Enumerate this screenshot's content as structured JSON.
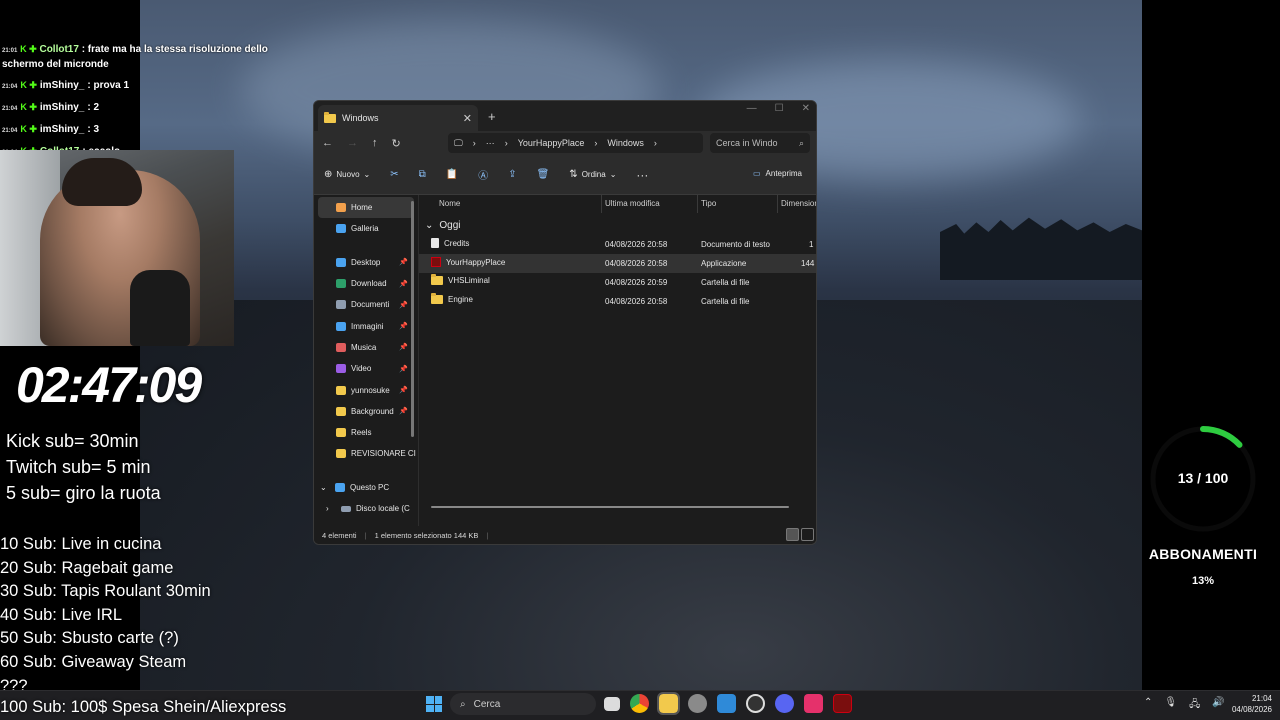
{
  "chat": [
    {
      "time": "21:01",
      "user": "Collot17",
      "user_color": "#b6ff9c",
      "message": ": frate ma ha la stessa risoluzione dello schermo del micronde"
    },
    {
      "time": "21:04",
      "user": "imShiny_",
      "user_color": "#ffffff",
      "message": ": prova 1"
    },
    {
      "time": "21:04",
      "user": "imShiny_",
      "user_color": "#ffffff",
      "message": ": 2"
    },
    {
      "time": "21:04",
      "user": "imShiny_",
      "user_color": "#ffffff",
      "message": ": 3"
    },
    {
      "time": "21:04",
      "user": "Collot17",
      "user_color": "#b6ff9c",
      "message": ": eccolo"
    }
  ],
  "stream": {
    "timer": "02:47:09",
    "rules": [
      "Kick sub= 30min",
      "Twitch sub= 5 min",
      "5 sub= giro la ruota"
    ],
    "goals": [
      "10 Sub: Live in cucina",
      "20 Sub: Ragebait game",
      "30 Sub: Tapis Roulant 30min",
      "40 Sub: Live IRL",
      "50 Sub: Sbusto carte (?)",
      "60 Sub: Giveaway Steam",
      "???",
      "100 Sub: 100$ Spesa Shein/Aliexpress"
    ]
  },
  "subs_gauge": {
    "count": "13 / 100",
    "title": "ABBONAMENTI",
    "percent_label": "13%",
    "progress": 0.13,
    "color": "#2ecc40"
  },
  "explorer": {
    "tab_title": "Windows",
    "address": {
      "crumbs": [
        "YourHappyPlace",
        "Windows"
      ]
    },
    "search_placeholder": "Cerca in Windo",
    "toolbar": {
      "new_label": "Nuovo",
      "sort_label": "Ordina",
      "preview_label": "Anteprima"
    },
    "sidebar": {
      "top": [
        {
          "label": "Home",
          "icon": "home-icon",
          "color": "#f2a04c"
        },
        {
          "label": "Galleria",
          "icon": "gallery-icon",
          "color": "#4aa3f0"
        }
      ],
      "pinned": [
        {
          "label": "Desktop",
          "icon": "desktop-icon",
          "color": "#4aa3f0"
        },
        {
          "label": "Download",
          "icon": "download-icon",
          "color": "#2d9f6a"
        },
        {
          "label": "Documenti",
          "icon": "documents-icon",
          "color": "#8f9db0"
        },
        {
          "label": "Immagini",
          "icon": "pictures-icon",
          "color": "#4aa3f0"
        },
        {
          "label": "Musica",
          "icon": "music-icon",
          "color": "#e05d5d"
        },
        {
          "label": "Video",
          "icon": "video-icon",
          "color": "#9b5de5"
        },
        {
          "label": "yunnosuke",
          "icon": "folder-icon",
          "color": "#f2c94c"
        },
        {
          "label": "Background",
          "icon": "folder-icon",
          "color": "#f2c94c"
        },
        {
          "label": "Reels",
          "icon": "folder-icon",
          "color": "#f2c94c"
        },
        {
          "label": "REVISIONARE CI",
          "icon": "folder-icon",
          "color": "#f2c94c"
        }
      ],
      "this_pc": "Questo PC",
      "local_disk": "Disco locale (C"
    },
    "columns": [
      "Nome",
      "Ultima modifica",
      "Tipo",
      "Dimension"
    ],
    "group_label": "Oggi",
    "files": [
      {
        "name": "Credits",
        "modified": "04/08/2026 20:58",
        "type": "Documento di testo",
        "size": "1 I",
        "icon": "text-document-icon"
      },
      {
        "name": "YourHappyPlace",
        "modified": "04/08/2026 20:58",
        "type": "Applicazione",
        "size": "144 I",
        "icon": "application-icon"
      },
      {
        "name": "VHSLiminal",
        "modified": "04/08/2026 20:59",
        "type": "Cartella di file",
        "size": "",
        "icon": "folder-icon"
      },
      {
        "name": "Engine",
        "modified": "04/08/2026 20:58",
        "type": "Cartella di file",
        "size": "",
        "icon": "folder-icon"
      }
    ],
    "status": {
      "count": "4 elementi",
      "selected": "1 elemento selezionato  144 KB"
    }
  },
  "taskbar": {
    "search_placeholder": "Cerca",
    "time": "21:04",
    "date": "04/08/2026"
  }
}
